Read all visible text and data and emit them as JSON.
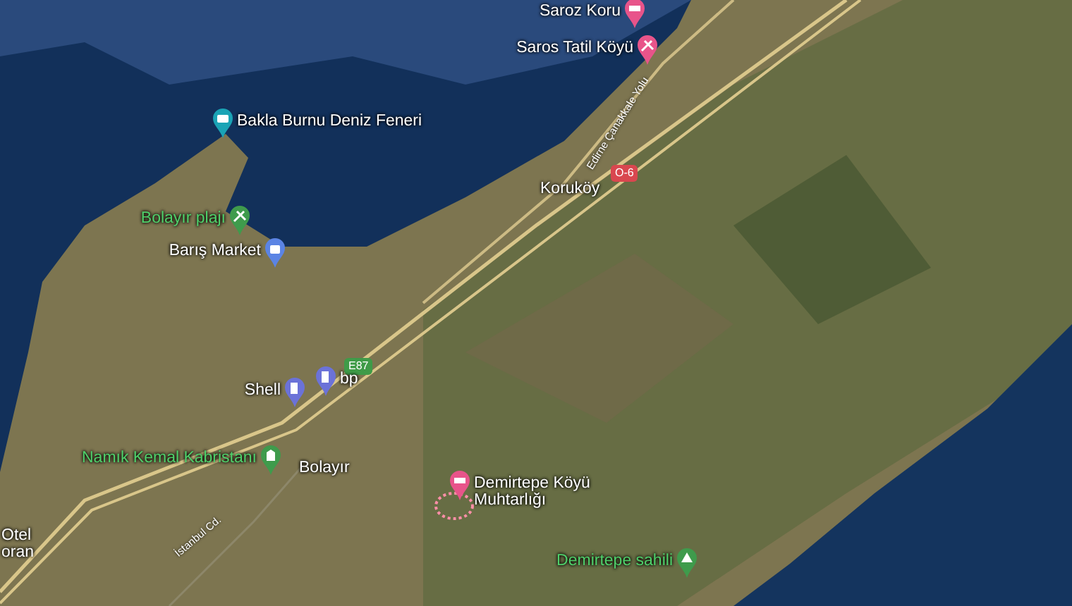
{
  "map": {
    "places": [
      {
        "label": "Saroz Koru",
        "kind": "hotel",
        "color": "#e8548a"
      },
      {
        "label": "Saros Tatil Köyü",
        "kind": "beach",
        "color": "#e8548a"
      },
      {
        "label": "Bakla Burnu Deniz Feneri",
        "kind": "camera",
        "color": "#1aa3b5"
      },
      {
        "label": "Bolayır plajı",
        "kind": "beach",
        "color": "#3f9b4c"
      },
      {
        "label": "Barış Market",
        "kind": "shop",
        "color": "#5b84e4"
      },
      {
        "label": "Shell",
        "kind": "fuel",
        "color": "#6b72d8"
      },
      {
        "label": "bp",
        "kind": "fuel",
        "color": "#6b72d8"
      },
      {
        "label": "Namık Kemal Kabristanı",
        "kind": "cemetery",
        "color": "#3f9b4c"
      },
      {
        "label": "Demirtepe Köyü Muhtarlığı",
        "kind": "office",
        "color": "#e8548a"
      },
      {
        "label": "Demirtepe sahili",
        "kind": "camping",
        "color": "#3f9b4c"
      }
    ],
    "localities": [
      {
        "label": "Koruköy"
      },
      {
        "label": "Bolayır"
      },
      {
        "label": "Otel oran"
      }
    ],
    "roads": [
      {
        "label": "Edirne Çanakkale Yolu"
      },
      {
        "label": "İstanbul Cd."
      }
    ],
    "route_shields": [
      {
        "label": "E87",
        "color": "#3f9b48"
      },
      {
        "label": "O-6",
        "color": "#d9474f"
      }
    ]
  }
}
